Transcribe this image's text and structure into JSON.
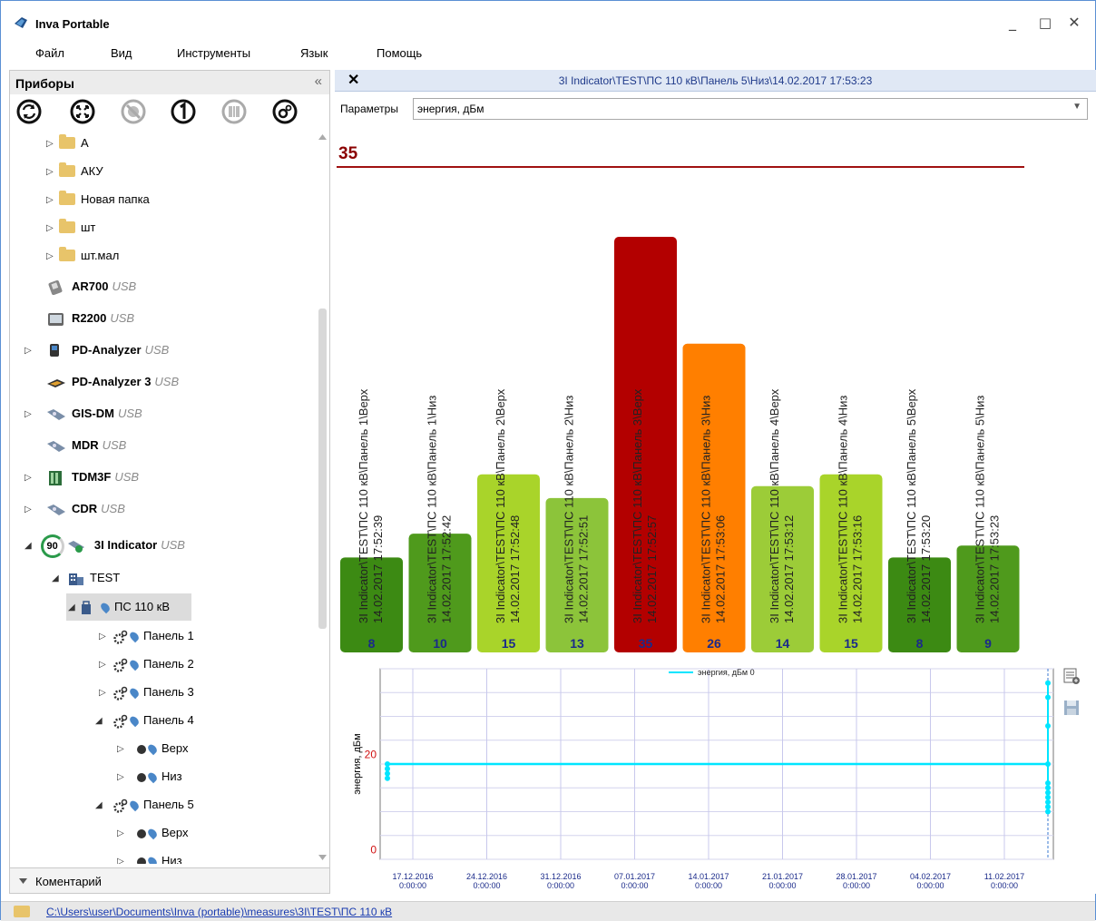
{
  "app": {
    "title": "Inva Portable"
  },
  "window_controls": {
    "minimize": "_",
    "maximize": "□",
    "close": "✕"
  },
  "menu": [
    "Файл",
    "Вид",
    "Инструменты",
    "Язык",
    "Помощь"
  ],
  "left_panel": {
    "title": "Приборы",
    "collapse": "«",
    "toolbar_icons": [
      "refresh-icon",
      "expand-icon",
      "disabled-icon",
      "one-icon",
      "barcode-icon",
      "settings-icon"
    ],
    "tree": [
      {
        "label": "А",
        "type": "folder",
        "level": 0,
        "arrow": "▷"
      },
      {
        "label": "АКУ",
        "type": "folder",
        "level": 0,
        "arrow": "▷"
      },
      {
        "label": "Новая папка",
        "type": "folder",
        "level": 0,
        "arrow": "▷"
      },
      {
        "label": "шт",
        "type": "folder",
        "level": 0,
        "arrow": "▷"
      },
      {
        "label": "шт.мал",
        "type": "folder",
        "level": 0,
        "arrow": "▷"
      },
      {
        "label": "AR700",
        "usb": "USB",
        "type": "device",
        "level": 0
      },
      {
        "label": "R2200",
        "usb": "USB",
        "type": "device",
        "level": 0
      },
      {
        "label": "PD-Analyzer",
        "usb": "USB",
        "type": "device",
        "level": 0,
        "arrow": "▷"
      },
      {
        "label": "PD-Analyzer 3",
        "usb": "USB",
        "type": "device",
        "level": 0
      },
      {
        "label": "GIS-DM",
        "usb": "USB",
        "type": "device",
        "level": 0,
        "arrow": "▷"
      },
      {
        "label": "MDR",
        "usb": "USB",
        "type": "device",
        "level": 0
      },
      {
        "label": "TDM3F",
        "usb": "USB",
        "type": "device",
        "level": 0,
        "arrow": "▷"
      },
      {
        "label": "CDR",
        "usb": "USB",
        "type": "device",
        "level": 0,
        "arrow": "▷"
      },
      {
        "label": "3I Indicator",
        "usb": "USB",
        "badge": "90",
        "type": "device",
        "level": 0,
        "arrow": "◢"
      },
      {
        "label": "TEST",
        "type": "building",
        "level": 1,
        "arrow": "◢"
      },
      {
        "label": "ПС 110 кВ",
        "type": "substation",
        "level": 2,
        "arrow": "◢",
        "selected": true
      },
      {
        "label": "Панель 1",
        "type": "panel",
        "level": 3,
        "arrow": "▷"
      },
      {
        "label": "Панель 2",
        "type": "panel",
        "level": 3,
        "arrow": "▷"
      },
      {
        "label": "Панель 3",
        "type": "panel",
        "level": 3,
        "arrow": "▷"
      },
      {
        "label": "Панель 4",
        "type": "panel",
        "level": 3,
        "arrow": "◢"
      },
      {
        "label": "Верх",
        "type": "sensor",
        "level": 4,
        "arrow": "▷"
      },
      {
        "label": "Низ",
        "type": "sensor",
        "level": 4,
        "arrow": "▷"
      },
      {
        "label": "Панель 5",
        "type": "panel",
        "level": 3,
        "arrow": "◢"
      },
      {
        "label": "Верх",
        "type": "sensor",
        "level": 4,
        "arrow": "▷"
      },
      {
        "label": "Низ",
        "type": "sensor",
        "level": 4,
        "arrow": "▷"
      }
    ],
    "comments": "Коментарий"
  },
  "document": {
    "title": "3I Indicator\\TEST\\ПС 110 кВ\\Панель 5\\Низ\\14.02.2017 17:53:23",
    "params_label": "Параметры",
    "params_value": "энергия, дБм"
  },
  "chart_data": [
    {
      "type": "bar",
      "max_label": "35",
      "categories": [
        "3I Indicator\\TEST\\ПС 110 кВ\\Панель 1\\Верх|14.02.2017 17:52:39",
        "3I Indicator\\TEST\\ПС 110 кВ\\Панель 1\\Низ|14.02.2017 17:52:42",
        "3I Indicator\\TEST\\ПС 110 кВ\\Панель 2\\Верх|14.02.2017 17:52:48",
        "3I Indicator\\TEST\\ПС 110 кВ\\Панель 2\\Низ|14.02.2017 17:52:51",
        "3I Indicator\\TEST\\ПС 110 кВ\\Панель 3\\Верх|14.02.2017 17:52:57",
        "3I Indicator\\TEST\\ПС 110 кВ\\Панель 3\\Низ|14.02.2017 17:53:06",
        "3I Indicator\\TEST\\ПС 110 кВ\\Панель 4\\Верх|14.02.2017 17:53:12",
        "3I Indicator\\TEST\\ПС 110 кВ\\Панель 4\\Низ|14.02.2017 17:53:16",
        "3I Indicator\\TEST\\ПС 110 кВ\\Панель 5\\Верх|14.02.2017 17:53:20",
        "3I Indicator\\TEST\\ПС 110 кВ\\Панель 5\\Низ|14.02.2017 17:53:23"
      ],
      "values": [
        8,
        10,
        15,
        13,
        35,
        26,
        14,
        15,
        8,
        9
      ],
      "colors": [
        "#3c8a13",
        "#4f9a1c",
        "#a9d42a",
        "#8cc43a",
        "#b30000",
        "#ff7f00",
        "#9ccc38",
        "#a9d42a",
        "#3c8a13",
        "#4f9a1c"
      ],
      "ylim": [
        0,
        35
      ]
    },
    {
      "type": "line",
      "series": [
        {
          "name": "энергия, дБм 0",
          "color": "#00e5ff",
          "value": 18
        }
      ],
      "ylabel": "энергия, дБм",
      "yticks": [
        0,
        20
      ],
      "ylim": [
        -2,
        38
      ],
      "x_ticks": [
        "17.12.2016",
        "24.12.2016",
        "31.12.2016",
        "07.01.2017",
        "14.01.2017",
        "21.01.2017",
        "28.01.2017",
        "04.02.2017",
        "11.02.2017"
      ],
      "x_tick_time": "0:00:00",
      "left_points": [
        18,
        17,
        16,
        15
      ],
      "right_points": [
        35,
        32,
        26,
        18,
        14,
        13,
        12,
        11,
        10,
        9,
        8
      ]
    }
  ],
  "status": {
    "path": "C:\\Users\\user\\Documents\\Inva (portable)\\measures\\3I\\TEST\\ПС 110 кВ"
  }
}
